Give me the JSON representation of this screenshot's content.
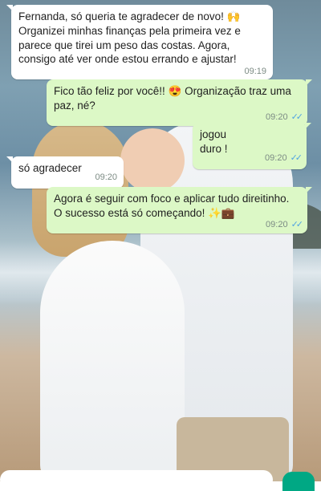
{
  "messages": [
    {
      "direction": "in",
      "text": "Fernanda, só queria te agradecer de novo! 🙌 Organizei minhas finanças pela primeira vez e parece que tirei um peso das costas. Agora, consigo até ver onde estou errando e ajustar!",
      "time": "09:19"
    },
    {
      "direction": "out",
      "text": "Fico tão feliz por você!! 😍 Organização traz uma paz, né?",
      "time": "09:20",
      "status": "read"
    },
    {
      "direction": "out",
      "text": "jogou duro !",
      "time": "09:20",
      "status": "read"
    },
    {
      "direction": "in",
      "text": "só agradecer",
      "time": "09:20"
    },
    {
      "direction": "out",
      "text": "Agora é seguir com foco e aplicar tudo direitinho. O sucesso está só começando! ✨💼",
      "time": "09:20",
      "status": "read"
    }
  ],
  "colors": {
    "incoming": "#ffffff",
    "outgoing": "#dcf8c6",
    "read_ticks": "#4fa3e3",
    "accent": "#00a884"
  },
  "icons": {
    "read_status": "double-check-icon",
    "send": "mic-icon"
  }
}
